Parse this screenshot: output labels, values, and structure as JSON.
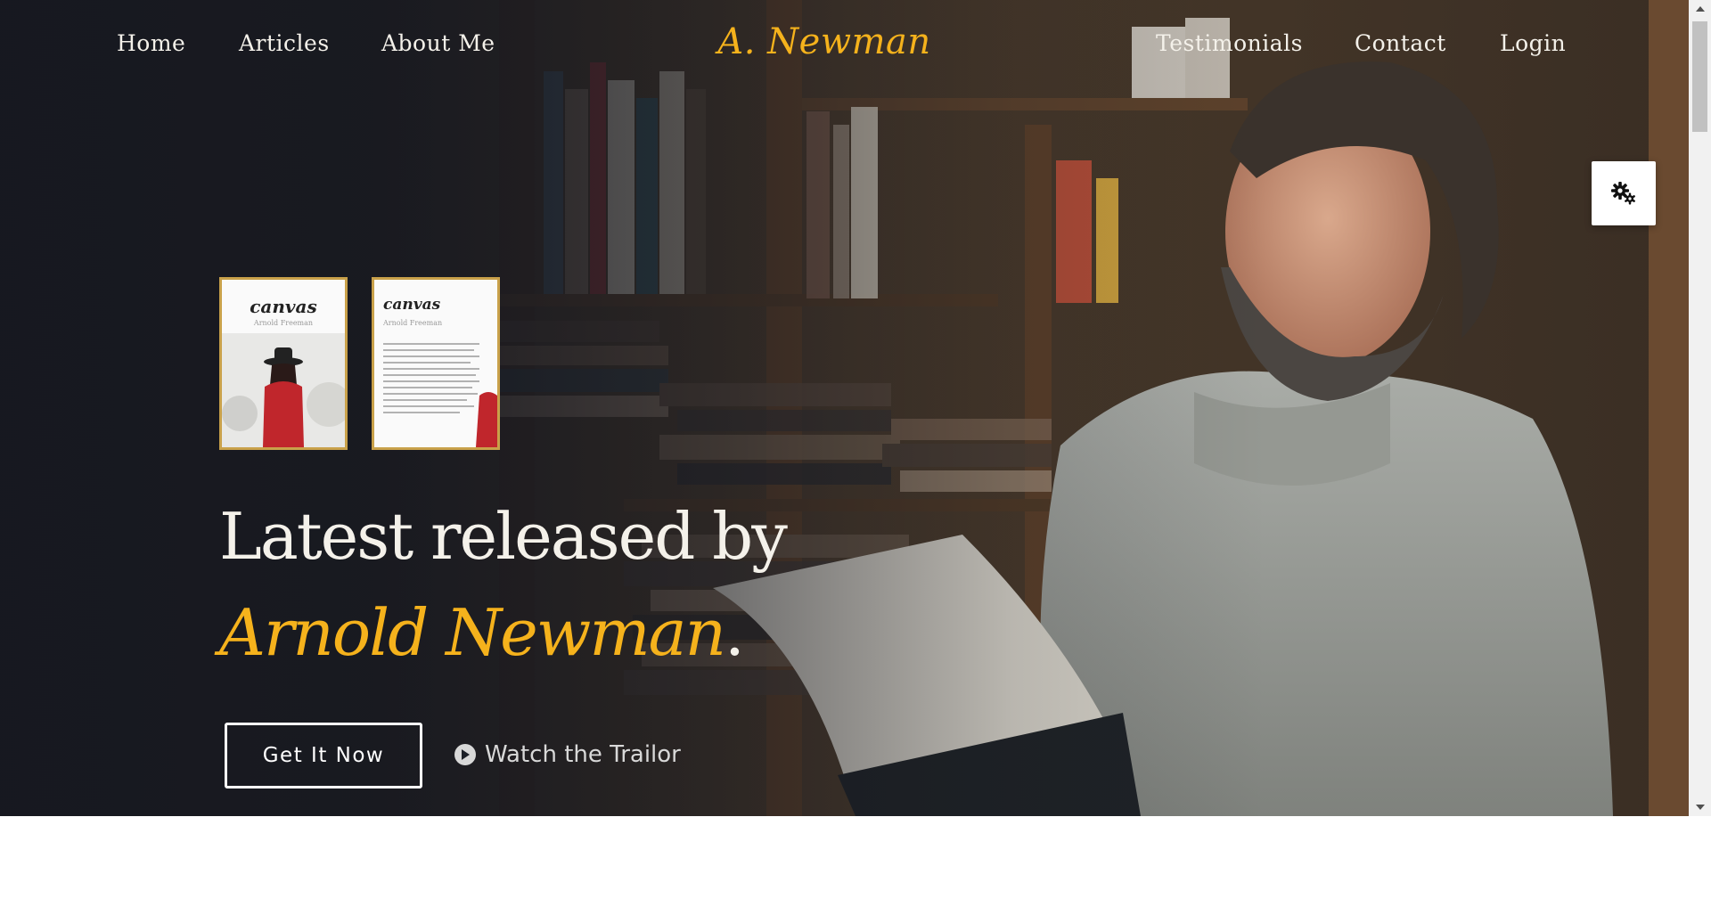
{
  "nav": {
    "left": [
      "Home",
      "Articles",
      "About Me"
    ],
    "right": [
      "Testimonials",
      "Contact",
      "Login"
    ]
  },
  "logo": "A. Newman",
  "books": [
    {
      "title": "canvas",
      "author": "Arnold Freeman"
    },
    {
      "title": "canvas",
      "author": "Arnold Freeman"
    }
  ],
  "hero": {
    "line1": "Latest released by",
    "line2": "Arnold Newman",
    "line2_suffix": ".",
    "cta_label": "Get It Now",
    "trailer_label": "Watch the Trailor"
  },
  "icons": {
    "settings": "gear-icon",
    "play": "play-circle-icon"
  },
  "colors": {
    "accent": "#f5b21c",
    "background": "#1c1f27",
    "text": "#f4f1ea"
  }
}
